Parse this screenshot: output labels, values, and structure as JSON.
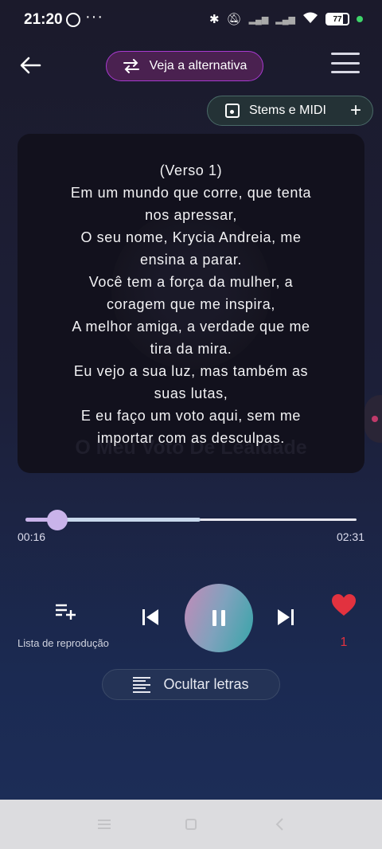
{
  "status_bar": {
    "time": "21:20",
    "battery": "77"
  },
  "header": {
    "alternative_label": "Veja a alternativa",
    "stems_label": "Stems e MIDI"
  },
  "lyrics": {
    "background_title": "O Meu Voto De Lealdade",
    "lines": [
      "(Verso 1)",
      "Em um mundo que corre, que tenta",
      "nos apressar,",
      "O seu nome, Krycia Andreia, me",
      "ensina a parar.",
      "Você tem a força da mulher, a",
      "coragem que me inspira,",
      "A melhor amiga, a verdade que me",
      "tira da mira.",
      "Eu vejo a sua luz, mas também as",
      "suas lutas,",
      "E eu faço um voto aqui, sem me",
      "importar com as desculpas."
    ]
  },
  "player": {
    "current_time": "00:16",
    "total_time": "02:31",
    "progress": 0.096,
    "buffered": 0.53,
    "playlist_label": "Lista de reprodução",
    "like_count": "1",
    "hide_lyrics_label": "Ocultar letras"
  },
  "colors": {
    "accent_purple": "#a83ad0",
    "progress_fill": "#c9b3ea",
    "like_red": "#e2323f",
    "play_gradient_start": "#c48ab8",
    "play_gradient_end": "#35a5a8"
  },
  "icons": [
    "whatsapp-icon",
    "bluetooth-icon",
    "mute-icon",
    "signal-icon",
    "wifi-icon",
    "battery-icon",
    "back-arrow-icon",
    "swap-icon",
    "menu-icon",
    "music-note-icon",
    "plus-icon",
    "playlist-add-icon",
    "skip-previous-icon",
    "pause-icon",
    "skip-next-icon",
    "heart-icon",
    "lines-icon"
  ]
}
